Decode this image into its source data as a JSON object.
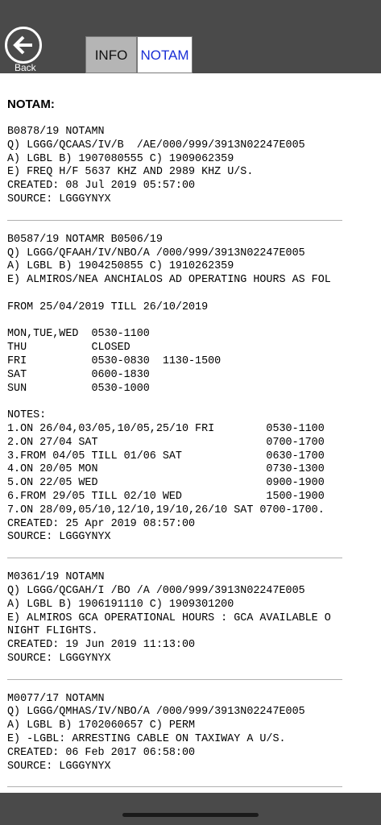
{
  "header": {
    "back_label": "Back",
    "tabs": [
      {
        "label": "INFO",
        "active": false
      },
      {
        "label": "NOTAM",
        "active": true
      }
    ]
  },
  "content": {
    "heading": "NOTAM:",
    "entries": [
      {
        "text": "B0878/19 NOTAMN\nQ) LGGG/QCAAS/IV/B  /AE/000/999/3913N02247E005\nA) LGBL B) 1907080555 C) 1909062359\nE) FREQ H/F 5637 KHZ AND 2989 KHZ U/S.\nCREATED: 08 Jul 2019 05:57:00\nSOURCE: LGGGYNYX"
      },
      {
        "text": "B0587/19 NOTAMR B0506/19\nQ) LGGG/QFAAH/IV/NBO/A /000/999/3913N02247E005\nA) LGBL B) 1904250855 C) 1910262359\nE) ALMIROS/NEA ANCHIALOS AD OPERATING HOURS AS FOL\n\nFROM 25/04/2019 TILL 26/10/2019\n\nMON,TUE,WED  0530-1100\nTHU          CLOSED\nFRI          0530-0830  1130-1500\nSAT          0600-1830\nSUN          0530-1000\n\nNOTES:\n1.ON 26/04,03/05,10/05,25/10 FRI        0530-1100\n2.ON 27/04 SAT                          0700-1700\n3.FROM 04/05 TILL 01/06 SAT             0630-1700\n4.ON 20/05 MON                          0730-1300\n5.ON 22/05 WED                          0900-1900\n6.FROM 29/05 TILL 02/10 WED             1500-1900\n7.ON 28/09,05/10,12/10,19/10,26/10 SAT 0700-1700.\nCREATED: 25 Apr 2019 08:57:00\nSOURCE: LGGGYNYX"
      },
      {
        "text": "M0361/19 NOTAMN\nQ) LGGG/QCGAH/I /BO /A /000/999/3913N02247E005\nA) LGBL B) 1906191110 C) 1909301200\nE) ALMIROS GCA OPERATIONAL HOURS : GCA AVAILABLE O\nNIGHT FLIGHTS.\nCREATED: 19 Jun 2019 11:13:00\nSOURCE: LGGGYNYX"
      },
      {
        "text": "M0077/17 NOTAMN\nQ) LGGG/QMHAS/IV/NBO/A /000/999/3913N02247E005\nA) LGBL B) 1702060657 C) PERM\nE) -LGBL: ARRESTING CABLE ON TAXIWAY A U/S.\nCREATED: 06 Feb 2017 06:58:00\nSOURCE: LGGGYNYX"
      }
    ]
  },
  "colors": {
    "bar": "#4a4a4a",
    "active_tab_text": "#1a2fd6",
    "inactive_tab_bg": "#b5b5b5"
  },
  "icons": {
    "back": "arrow-left-circle-icon"
  }
}
